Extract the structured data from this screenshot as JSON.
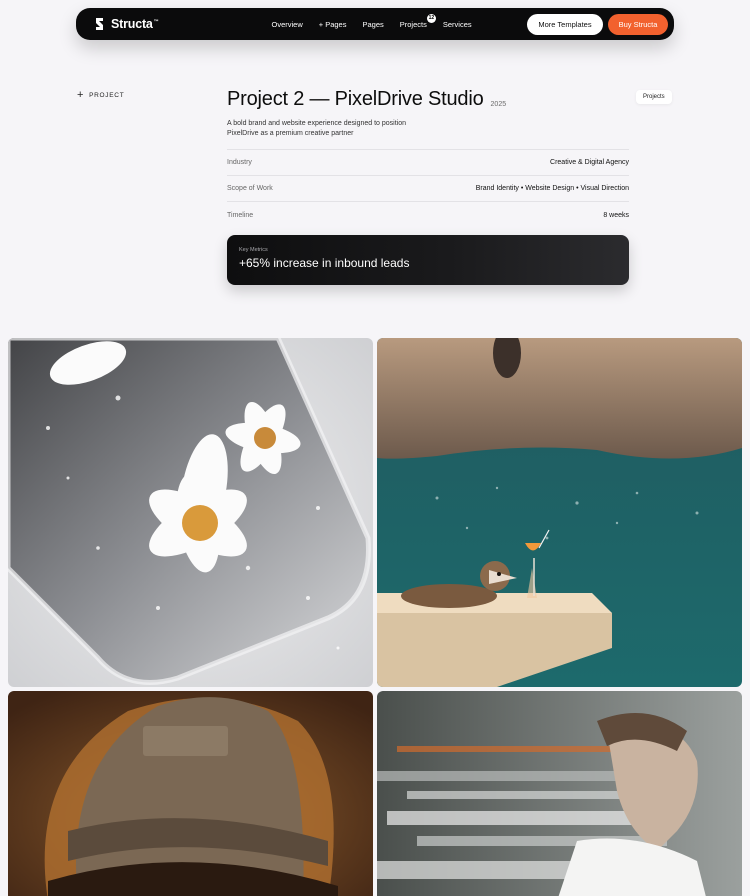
{
  "nav": {
    "brand": "Structa",
    "brand_mark": "™",
    "links": [
      {
        "label": "Overview"
      },
      {
        "label": "+ Pages"
      },
      {
        "label": "Pages"
      },
      {
        "label": "Projects",
        "count": "12"
      },
      {
        "label": "Services"
      }
    ],
    "more_templates": "More Templates",
    "buy": "Buy Structa"
  },
  "side": {
    "section_label": "PROJECT",
    "chip": "Projects"
  },
  "project": {
    "title": "Project 2 — PixelDrive Studio",
    "year": "2025",
    "description": "A bold brand and website experience designed to position PixelDrive as a premium creative partner",
    "meta": [
      {
        "key": "Industry",
        "value": "Creative & Digital Agency"
      },
      {
        "key": "Scope of Work",
        "value": "Brand Identity • Website Design • Visual Direction"
      },
      {
        "key": "Timeline",
        "value": "8 weeks"
      }
    ],
    "metric_label": "Key Metrics",
    "metric_value": "+65% increase in inbound leads"
  },
  "gallery": [
    {
      "subject": "daisies-in-water-image"
    },
    {
      "subject": "raccoon-by-sea-image"
    },
    {
      "subject": "cap-portrait-image"
    },
    {
      "subject": "motion-blur-portrait-image"
    }
  ],
  "colors": {
    "accent": "#f2612e",
    "nav_bg": "#0b0b0c",
    "page_bg": "#f6f5f8"
  }
}
